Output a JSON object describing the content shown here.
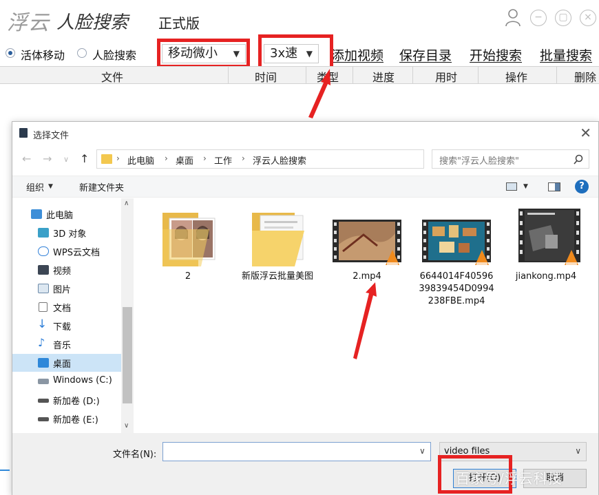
{
  "app": {
    "logo_fu": "浮云",
    "logo_rest": "人脸搜索",
    "edition": "正式版"
  },
  "options": {
    "mode_1": "活体移动",
    "mode_2": "人脸搜索",
    "sensitivity_value": "移动微小",
    "speed_value": "3x速",
    "links": [
      "添加视频",
      "保存目录",
      "开始搜索",
      "批量搜索"
    ]
  },
  "grid": {
    "columns": [
      "文件",
      "时间",
      "类型",
      "进度",
      "用时",
      "操作",
      "删除"
    ]
  },
  "dialog": {
    "title": "选择文件",
    "breadcrumbs": [
      "此电脑",
      "桌面",
      "工作",
      "浮云人脸搜索"
    ],
    "search_placeholder": "搜索\"浮云人脸搜索\"",
    "organize": "组织",
    "new_folder": "新建文件夹",
    "nav_items": [
      "此电脑",
      "3D 对象",
      "WPS云文档",
      "视频",
      "图片",
      "文档",
      "下载",
      "音乐",
      "桌面",
      "Windows (C:)",
      "新加卷 (D:)",
      "新加卷 (E:)"
    ],
    "files": [
      {
        "name": "2"
      },
      {
        "name": "新版浮云批量美图"
      },
      {
        "name": "2.mp4"
      },
      {
        "name": "6644014F4059639839454D0994238FBE.mp4"
      },
      {
        "name": "jiankong.mp4"
      }
    ],
    "filename_label": "文件名(N):",
    "filename_value": "",
    "filter_value": "video files",
    "open_button": "打开(O)",
    "cancel_button": "取消"
  },
  "watermark": "百家号/浮云科技",
  "colors": {
    "annotation": "#e62222",
    "selection": "#cce4f7",
    "help": "#1e6ebd"
  }
}
